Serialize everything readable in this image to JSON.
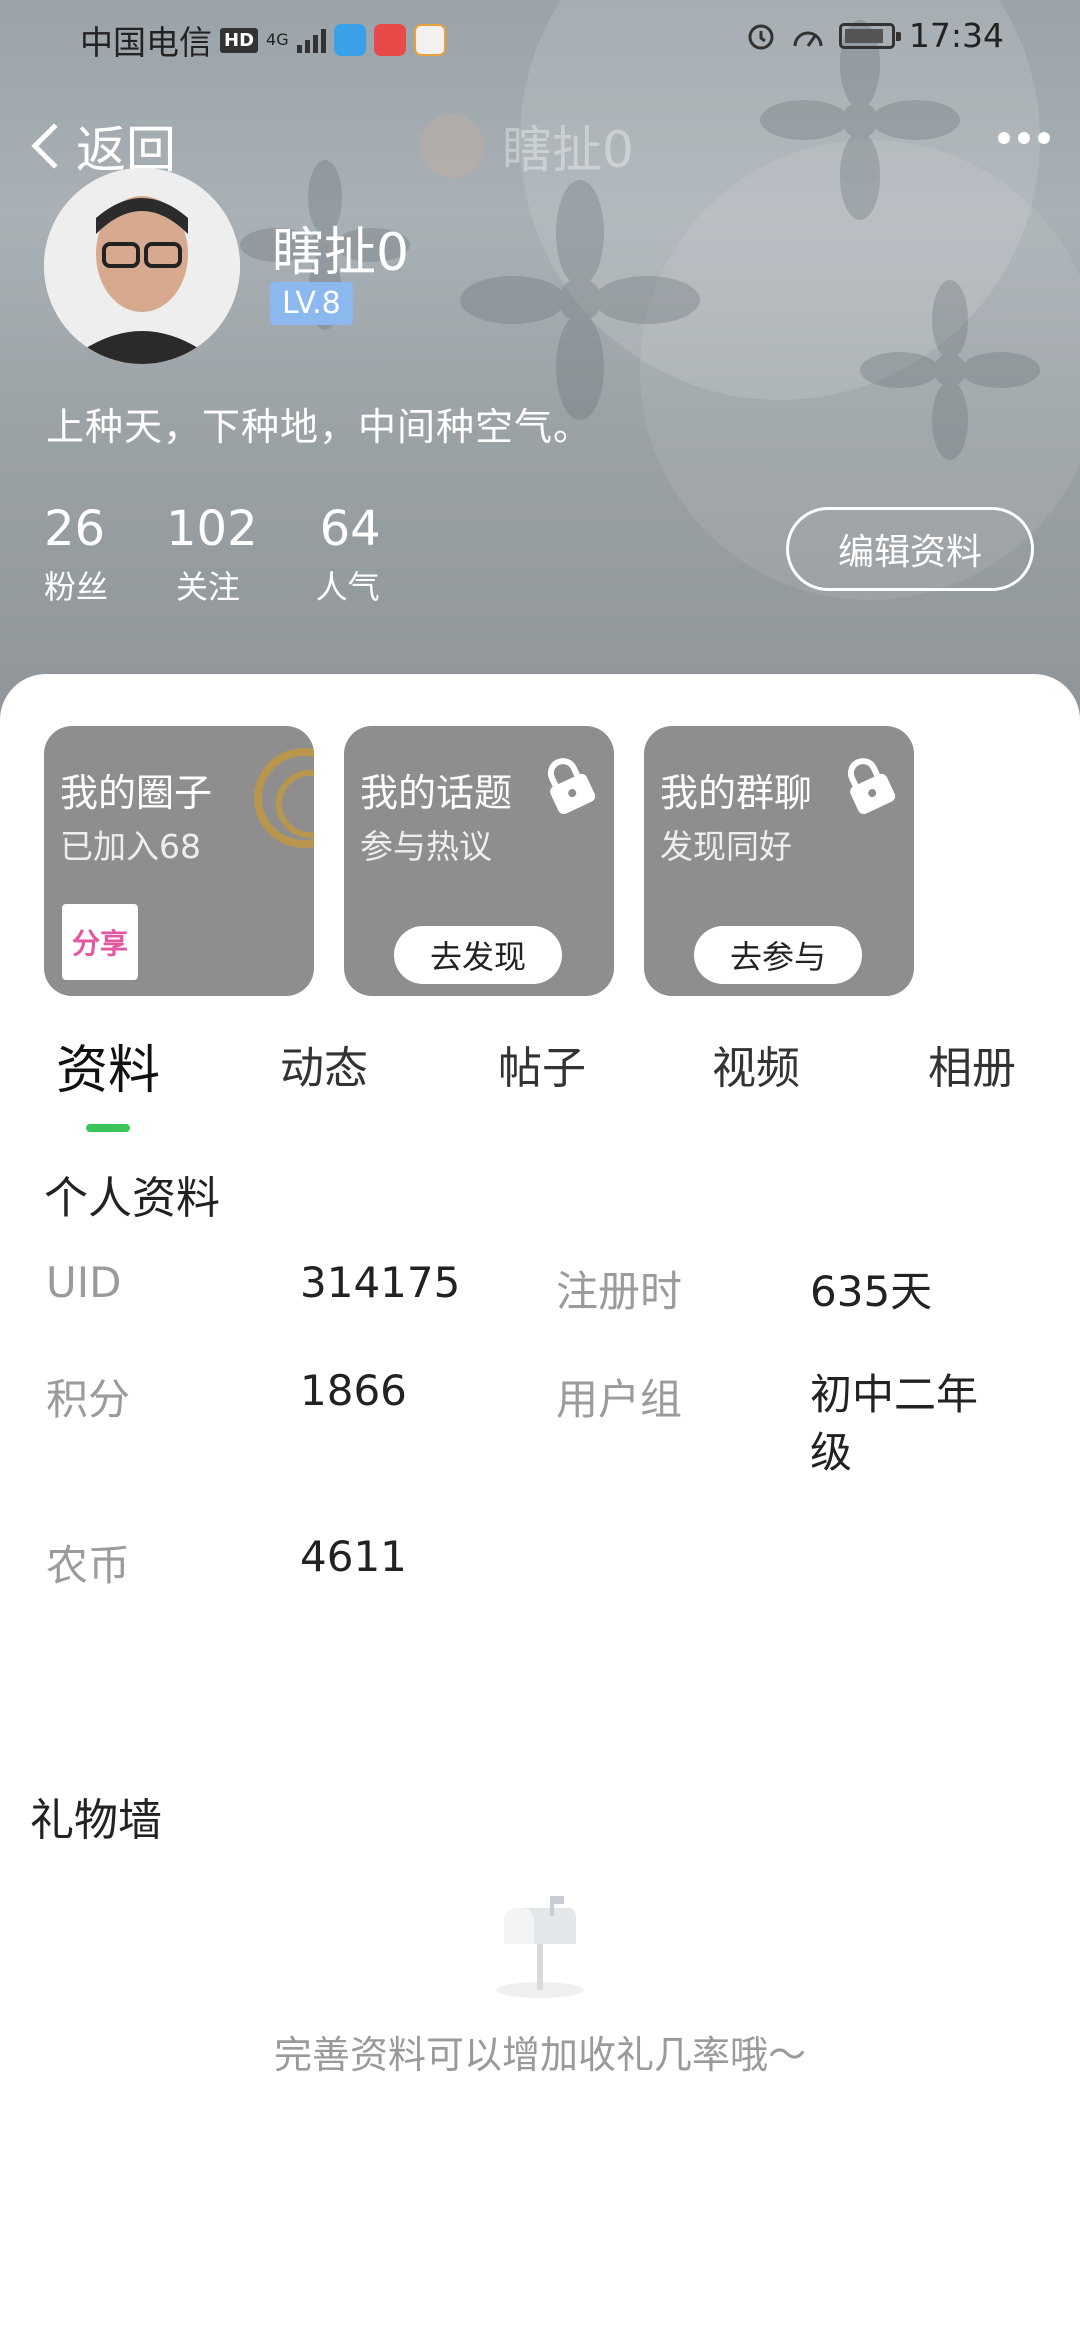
{
  "status_bar": {
    "carrier": "中国电信",
    "hd_badge": "HD",
    "signal_label": "4G",
    "time": "17:34"
  },
  "nav": {
    "back_label": "返回",
    "title": "瞎扯0",
    "more_icon": "more-dots-icon"
  },
  "profile": {
    "username": "瞎扯0",
    "level": "LV.8",
    "bio": "上种天，下种地，中间种空气。",
    "stats": [
      {
        "value": "26",
        "label": "粉丝"
      },
      {
        "value": "102",
        "label": "关注"
      },
      {
        "value": "64",
        "label": "人气"
      }
    ],
    "edit_button": "编辑资料"
  },
  "cards": [
    {
      "title": "我的圈子",
      "subtitle": "已加入68",
      "badge": "分享"
    },
    {
      "title": "我的话题",
      "subtitle": "参与热议",
      "action": "去发现"
    },
    {
      "title": "我的群聊",
      "subtitle": "发现同好",
      "action": "去参与"
    }
  ],
  "tabs": [
    "资料",
    "动态",
    "帖子",
    "视频",
    "相册"
  ],
  "active_tab": "资料",
  "personal_info": {
    "title": "个人资料",
    "fields": [
      {
        "key": "UID",
        "value": "314175"
      },
      {
        "key": "注册时",
        "value": "635天"
      },
      {
        "key": "积分",
        "value": "1866"
      },
      {
        "key": "用户组",
        "value": "初中二年级"
      },
      {
        "key": "农币",
        "value": "4611"
      }
    ]
  },
  "gift_wall": {
    "title": "礼物墙",
    "empty_text": "完善资料可以增加收礼几率哦～"
  },
  "colors": {
    "accent": "#3cc45c",
    "level_badge": "#8bb8ee",
    "card_bg": "#8e8e8e"
  }
}
